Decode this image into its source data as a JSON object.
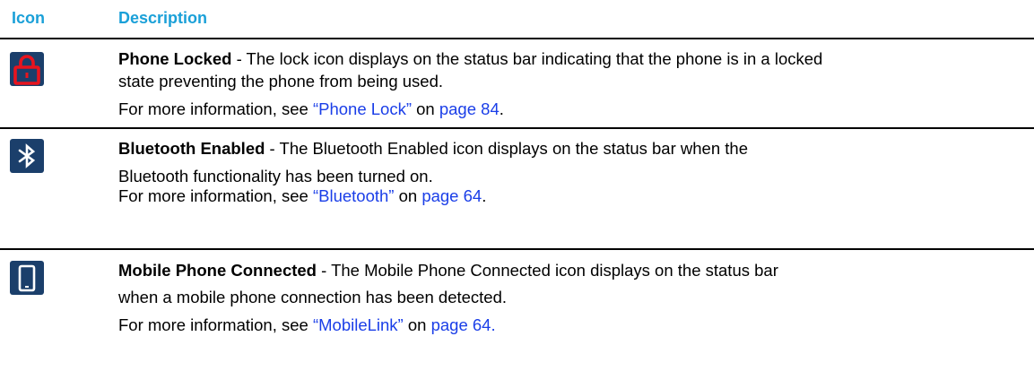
{
  "colors": {
    "header_text": "#1aa0d8",
    "link": "#1a3ee8",
    "icon_navy": "#1b3f6b",
    "lock_red": "#e8141e"
  },
  "header": {
    "icon_label": "Icon",
    "description_label": "Description"
  },
  "rows": [
    {
      "icon": "lock-icon",
      "title": "Phone Locked",
      "desc_line1": " - The lock icon displays on the status bar indicating that the phone is in a locked",
      "desc_line2": "state preventing the phone from being used.",
      "more_prefix": "For more information, see ",
      "ref_text": "“Phone Lock”",
      "on_text": " on ",
      "page_text": "page 84",
      "end_text": "."
    },
    {
      "icon": "bluetooth-icon",
      "title": "Bluetooth Enabled",
      "desc_line1": " - The Bluetooth Enabled icon displays on the status bar when the",
      "desc_line2": "Bluetooth functionality has been turned on.",
      "more_prefix": "For more information, see ",
      "ref_text": "“Bluetooth”",
      "on_text": " on ",
      "page_text": "page 64",
      "end_text": "."
    },
    {
      "icon": "mobile-phone-icon",
      "title": "Mobile Phone Connected",
      "desc_line1": " - The Mobile Phone Connected icon displays on the status bar",
      "desc_line2": "when a mobile phone connection has been detected.",
      "more_prefix": "For more information, see ",
      "ref_text": "“MobileLink”",
      "on_text": " on ",
      "page_text": "page 64.",
      "end_text": ""
    }
  ]
}
